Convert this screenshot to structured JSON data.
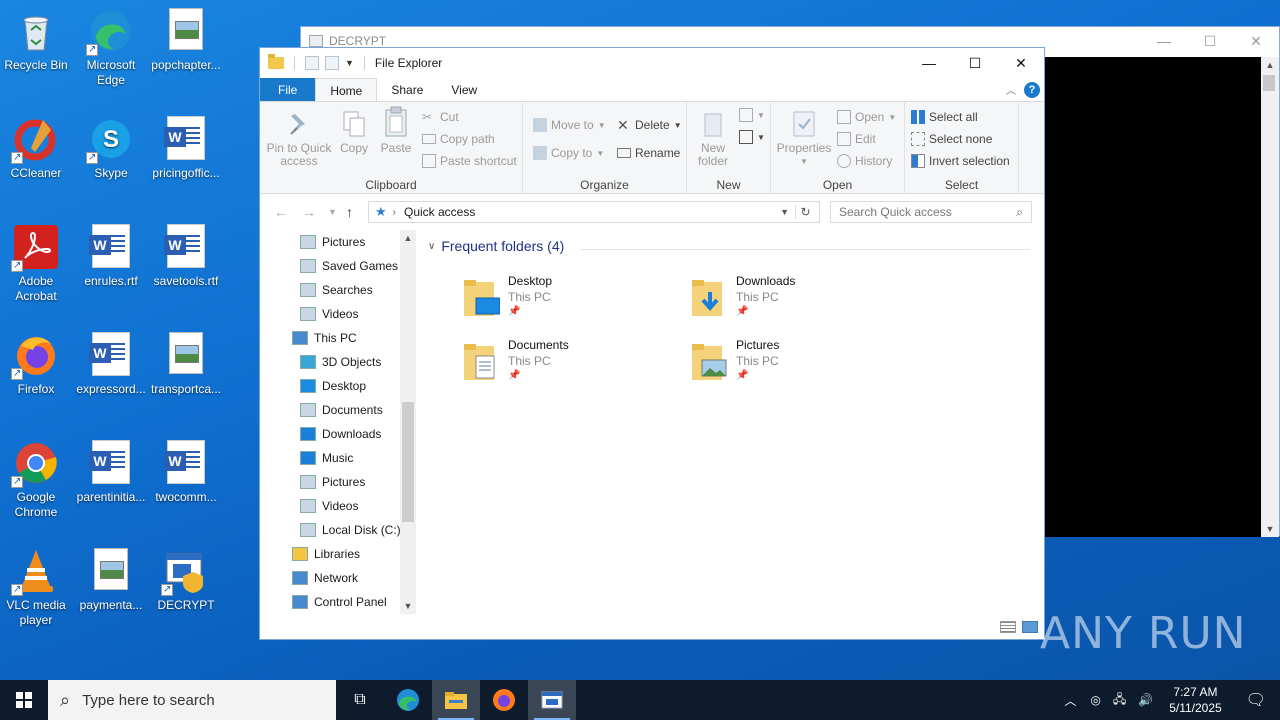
{
  "desktop": {
    "icons": [
      {
        "label": "Recycle Bin"
      },
      {
        "label": "Microsoft Edge"
      },
      {
        "label": "popchapter..."
      },
      {
        "label": "CCleaner"
      },
      {
        "label": "Skype"
      },
      {
        "label": "pricingoffic..."
      },
      {
        "label": "Adobe Acrobat"
      },
      {
        "label": "enrules.rtf"
      },
      {
        "label": "savetools.rtf"
      },
      {
        "label": "Firefox"
      },
      {
        "label": "expressord..."
      },
      {
        "label": "transportca..."
      },
      {
        "label": "Google Chrome"
      },
      {
        "label": "parentinitia..."
      },
      {
        "label": "twocomm..."
      },
      {
        "label": "VLC media player"
      },
      {
        "label": "paymenta..."
      },
      {
        "label": "DECRYPT"
      }
    ]
  },
  "decrypt_window": {
    "title": "DECRYPT"
  },
  "explorer": {
    "title": "File Explorer",
    "tabs": {
      "file": "File",
      "home": "Home",
      "share": "Share",
      "view": "View"
    },
    "ribbon": {
      "clipboard": {
        "pin": "Pin to Quick access",
        "copy": "Copy",
        "paste": "Paste",
        "cut": "Cut",
        "copy_path": "Copy path",
        "paste_shortcut": "Paste shortcut",
        "label": "Clipboard"
      },
      "organize": {
        "move_to": "Move to",
        "copy_to": "Copy to",
        "delete": "Delete",
        "rename": "Rename",
        "label": "Organize"
      },
      "new": {
        "new_folder": "New folder",
        "label": "New"
      },
      "open": {
        "properties": "Properties",
        "open": "Open",
        "edit": "Edit",
        "history": "History",
        "label": "Open"
      },
      "select": {
        "select_all": "Select all",
        "select_none": "Select none",
        "invert": "Invert selection",
        "label": "Select"
      }
    },
    "address": {
      "path": "Quick access",
      "search_placeholder": "Search Quick access"
    },
    "nav": [
      {
        "label": "Pictures",
        "indent": 1
      },
      {
        "label": "Saved Games",
        "indent": 1
      },
      {
        "label": "Searches",
        "indent": 1
      },
      {
        "label": "Videos",
        "indent": 1
      },
      {
        "label": "This PC",
        "indent": 0
      },
      {
        "label": "3D Objects",
        "indent": 1
      },
      {
        "label": "Desktop",
        "indent": 1
      },
      {
        "label": "Documents",
        "indent": 1
      },
      {
        "label": "Downloads",
        "indent": 1
      },
      {
        "label": "Music",
        "indent": 1
      },
      {
        "label": "Pictures",
        "indent": 1
      },
      {
        "label": "Videos",
        "indent": 1
      },
      {
        "label": "Local Disk (C:)",
        "indent": 1
      },
      {
        "label": "Libraries",
        "indent": 0
      },
      {
        "label": "Network",
        "indent": 0
      },
      {
        "label": "Control Panel",
        "indent": 0
      }
    ],
    "frequent_header": "Frequent folders (4)",
    "folders": [
      {
        "name": "Desktop",
        "location": "This PC"
      },
      {
        "name": "Downloads",
        "location": "This PC"
      },
      {
        "name": "Documents",
        "location": "This PC"
      },
      {
        "name": "Pictures",
        "location": "This PC"
      }
    ]
  },
  "taskbar": {
    "search_placeholder": "Type here to search",
    "time": "7:27 AM",
    "date": "5/11/2025"
  },
  "watermark": "ANY RUN"
}
